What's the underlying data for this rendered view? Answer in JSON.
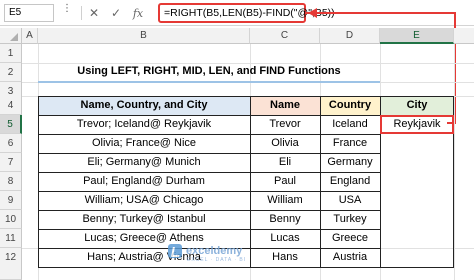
{
  "formula_bar": {
    "name_box": "E5",
    "cancel_icon": "✕",
    "enter_icon": "✓",
    "fx_label": "fx",
    "formula": "=RIGHT(B5,LEN(B5)-FIND(\"@\",B5))"
  },
  "columns": [
    "A",
    "B",
    "C",
    "D",
    "E"
  ],
  "selected_column": "E",
  "rows": [
    "1",
    "2",
    "3",
    "4",
    "5",
    "6",
    "7",
    "8",
    "9",
    "10",
    "11",
    "12"
  ],
  "selected_row": "5",
  "title": "Using LEFT, RIGHT, MID, LEN, and FIND Functions",
  "table": {
    "headers": {
      "b": "Name, Country, and City",
      "c": "Name",
      "d": "Country",
      "e": "City"
    },
    "header_colors": {
      "b": "#dde8f4",
      "c": "#fbe2d5",
      "d": "#fff2cc",
      "e": "#e2efda"
    },
    "rows": [
      {
        "b": "Trevor; Iceland@ Reykjavik",
        "c": "Trevor",
        "d": "Iceland",
        "e": "Reykjavik"
      },
      {
        "b": "Olivia; France@ Nice",
        "c": "Olivia",
        "d": "France",
        "e": ""
      },
      {
        "b": "Eli; Germany@ Munich",
        "c": "Eli",
        "d": "Germany",
        "e": ""
      },
      {
        "b": "Paul; England@ Durham",
        "c": "Paul",
        "d": "England",
        "e": ""
      },
      {
        "b": "William; USA@ Chicago",
        "c": "William",
        "d": "USA",
        "e": ""
      },
      {
        "b": "Benny; Turkey@ Istanbul",
        "c": "Benny",
        "d": "Turkey",
        "e": ""
      },
      {
        "b": "Lucas; Greece@ Athens",
        "c": "Lucas",
        "d": "Greece",
        "e": ""
      },
      {
        "b": "Hans; Austria@ Vienna",
        "c": "Hans",
        "d": "Austria",
        "e": ""
      }
    ]
  },
  "watermark": {
    "name": "exceldemy",
    "tagline": "EXCEL · DATA · BI"
  }
}
